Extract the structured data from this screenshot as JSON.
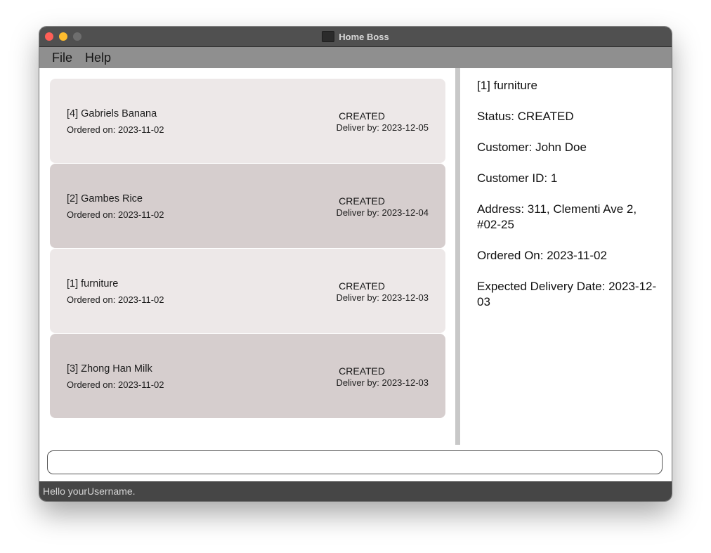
{
  "window": {
    "title": "Home Boss"
  },
  "menu": {
    "file": "File",
    "help": "Help"
  },
  "orders": [
    {
      "name": "[4] Gabriels Banana",
      "ordered": "Ordered on: 2023-11-02",
      "status": "CREATED",
      "deliver": "Deliver by: 2023-12-05"
    },
    {
      "name": "[2] Gambes Rice",
      "ordered": "Ordered on: 2023-11-02",
      "status": "CREATED",
      "deliver": "Deliver by: 2023-12-04"
    },
    {
      "name": "[1] furniture",
      "ordered": "Ordered on: 2023-11-02",
      "status": "CREATED",
      "deliver": "Deliver by: 2023-12-03"
    },
    {
      "name": "[3] Zhong Han Milk",
      "ordered": "Ordered on: 2023-11-02",
      "status": "CREATED",
      "deliver": "Deliver by: 2023-12-03"
    }
  ],
  "detail": {
    "title": "[1] furniture",
    "status": "Status: CREATED",
    "customer": "Customer: John Doe",
    "customer_id": "Customer ID: 1",
    "address": "Address: 311, Clementi Ave 2, #02-25",
    "ordered_on": "Ordered On: 2023-11-02",
    "expected_delivery": "Expected Delivery Date: 2023-12-03"
  },
  "command": {
    "value": ""
  },
  "status_bar": {
    "message": "Hello yourUsername."
  },
  "colors": {
    "card_light": "#ede8e8",
    "card_dark": "#d6cece",
    "menubar": "#8f8f8f",
    "titlebar": "#505050",
    "statusbar": "#464646"
  }
}
